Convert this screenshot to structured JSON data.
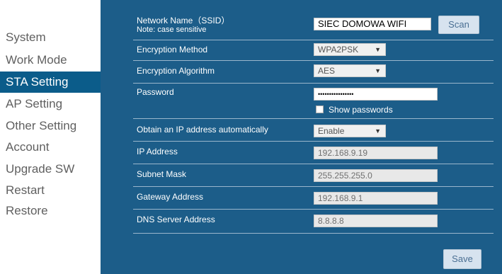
{
  "sidebar": {
    "items": [
      {
        "label": "System"
      },
      {
        "label": "Work Mode"
      },
      {
        "label": "STA Setting"
      },
      {
        "label": "AP Setting"
      },
      {
        "label": "Other Setting"
      },
      {
        "label": "Account"
      },
      {
        "label": "Upgrade SW"
      },
      {
        "label": "Restart"
      },
      {
        "label": "Restore"
      }
    ],
    "active_item": "STA Setting"
  },
  "form": {
    "ssid": {
      "label_line1": "Network Name（SSID）",
      "label_line2": "Note: case sensitive",
      "value": "SIEC DOMOWA WIFI"
    },
    "scan_button": "Scan",
    "encryption_method": {
      "label": "Encryption Method",
      "value": "WPA2PSK"
    },
    "encryption_algorithm": {
      "label": "Encryption Algorithm",
      "value": "AES"
    },
    "password": {
      "label": "Password",
      "value": "••••••••••••••••"
    },
    "show_passwords": "Show passwords",
    "obtain_ip": {
      "label": "Obtain an IP address automatically",
      "value": "Enable"
    },
    "ip_address": {
      "label": "IP Address",
      "value": "192.168.9.19"
    },
    "subnet_mask": {
      "label": "Subnet Mask",
      "value": "255.255.255.0"
    },
    "gateway": {
      "label": "Gateway Address",
      "value": "192.168.9.1"
    },
    "dns": {
      "label": "DNS Server Address",
      "value": "8.8.8.8"
    },
    "save_button": "Save"
  },
  "colors": {
    "panel": "#1c5d89",
    "active_sidebar": "#0b5c8a",
    "button": "#d7e3ef"
  }
}
